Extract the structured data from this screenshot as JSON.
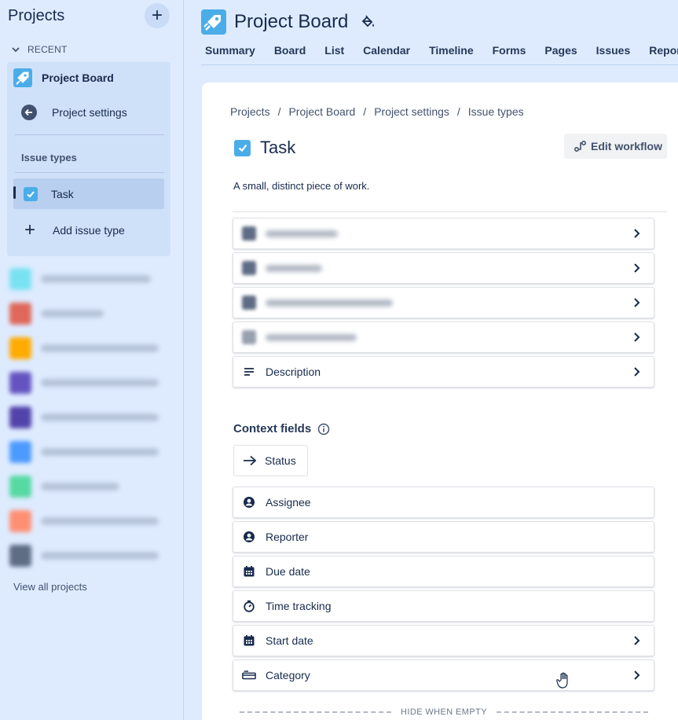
{
  "sidebar": {
    "title": "Projects",
    "add_label": "+",
    "recent_label": "RECENT",
    "project_name": "Project Board",
    "settings_label": "Project settings",
    "issue_types_label": "Issue types",
    "task_label": "Task",
    "add_issue_type_label": "Add issue type",
    "view_all_label": "View all projects",
    "blurred_projects": [
      {
        "color": "#79e2f2"
      },
      {
        "color": "#e0685a"
      },
      {
        "color": "#ffab00"
      },
      {
        "color": "#6554c0"
      },
      {
        "color": "#5243aa"
      },
      {
        "color": "#4c9aff"
      },
      {
        "color": "#57d9a3"
      },
      {
        "color": "#ff8f73"
      },
      {
        "color": "#5e6c84"
      }
    ]
  },
  "header": {
    "title": "Project Board",
    "tabs": [
      {
        "label": "Summary"
      },
      {
        "label": "Board"
      },
      {
        "label": "List"
      },
      {
        "label": "Calendar"
      },
      {
        "label": "Timeline"
      },
      {
        "label": "Forms"
      },
      {
        "label": "Pages"
      },
      {
        "label": "Issues"
      },
      {
        "label": "Reports"
      }
    ]
  },
  "main": {
    "breadcrumbs": [
      "Projects",
      "Project Board",
      "Project settings",
      "Issue types"
    ],
    "breadcrumb_sep": "/",
    "task_title": "Task",
    "edit_workflow_label": "Edit workflow",
    "description": "A small, distinct piece of work.",
    "description_field": "Description",
    "context_fields_title": "Context fields",
    "status_label": "Status",
    "context_fields": [
      {
        "label": "Assignee",
        "icon": "person-icon",
        "chevron": false
      },
      {
        "label": "Reporter",
        "icon": "person-icon",
        "chevron": false
      },
      {
        "label": "Due date",
        "icon": "calendar-icon",
        "chevron": false
      },
      {
        "label": "Time tracking",
        "icon": "stopwatch-icon",
        "chevron": false
      },
      {
        "label": "Start date",
        "icon": "calendar-icon",
        "chevron": true
      },
      {
        "label": "Category",
        "icon": "category-icon",
        "chevron": true
      }
    ],
    "hide_when_empty_label": "HIDE WHEN EMPTY"
  },
  "colors": {
    "accent": "#4bade8",
    "background": "#deebff",
    "text": "#172b4d"
  }
}
